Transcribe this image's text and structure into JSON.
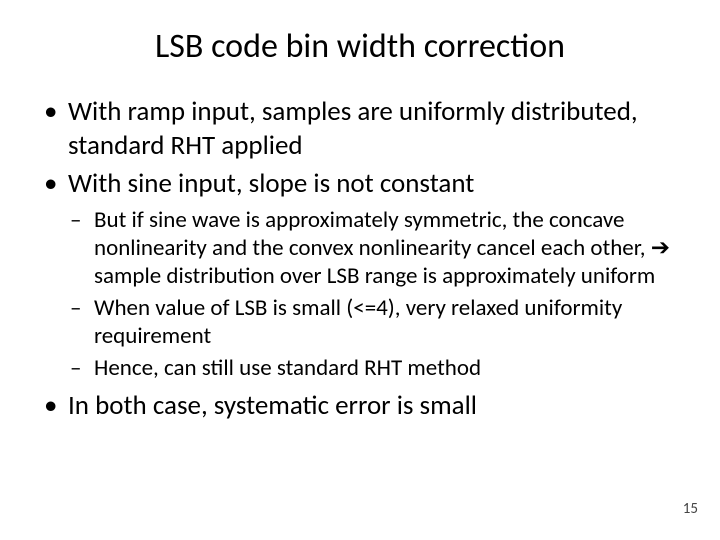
{
  "title": "LSB code bin width correction",
  "bullets": {
    "b1": "With ramp input, samples are uniformly distributed, standard RHT applied",
    "b2": "With sine input, slope is not constant",
    "b2_sub": {
      "s1": "But if sine wave is approximately symmetric, the concave nonlinearity and the convex nonlinearity cancel each other, ➔ sample distribution over LSB range is approximately uniform",
      "s2": "When value of LSB is small (<=4), very relaxed uniformity requirement",
      "s3": "Hence, can still use standard RHT method"
    },
    "b3": "In both case, systematic error is small"
  },
  "page_number": "15"
}
